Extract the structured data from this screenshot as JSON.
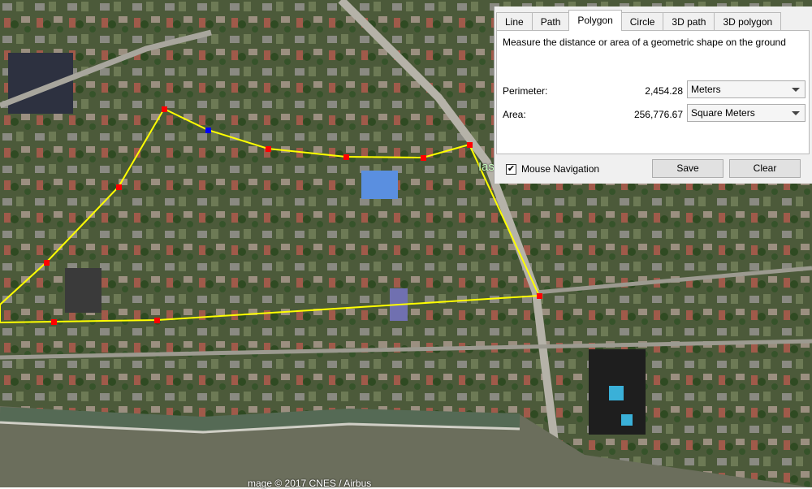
{
  "map": {
    "copyright": "mage © 2017 CNES / Airbus",
    "place_label": "Ias"
  },
  "measure": {
    "tabs": [
      {
        "label": "Line"
      },
      {
        "label": "Path"
      },
      {
        "label": "Polygon",
        "active": true
      },
      {
        "label": "Circle"
      },
      {
        "label": "3D path"
      },
      {
        "label": "3D polygon"
      }
    ],
    "description": "Measure the distance or area of a geometric shape on the ground",
    "perimeter": {
      "label": "Perimeter:",
      "value": "2,454.28",
      "unit": "Meters"
    },
    "area": {
      "label": "Area:",
      "value": "256,776.67",
      "unit": "Square Meters"
    },
    "mouse_navigation": {
      "label": "Mouse Navigation",
      "checked": true
    },
    "save_label": "Save",
    "clear_label": "Clear"
  },
  "colors": {
    "polygon_line": "#ffff00",
    "vertex": "#ff0000",
    "selected_vertex": "#0000ff"
  }
}
